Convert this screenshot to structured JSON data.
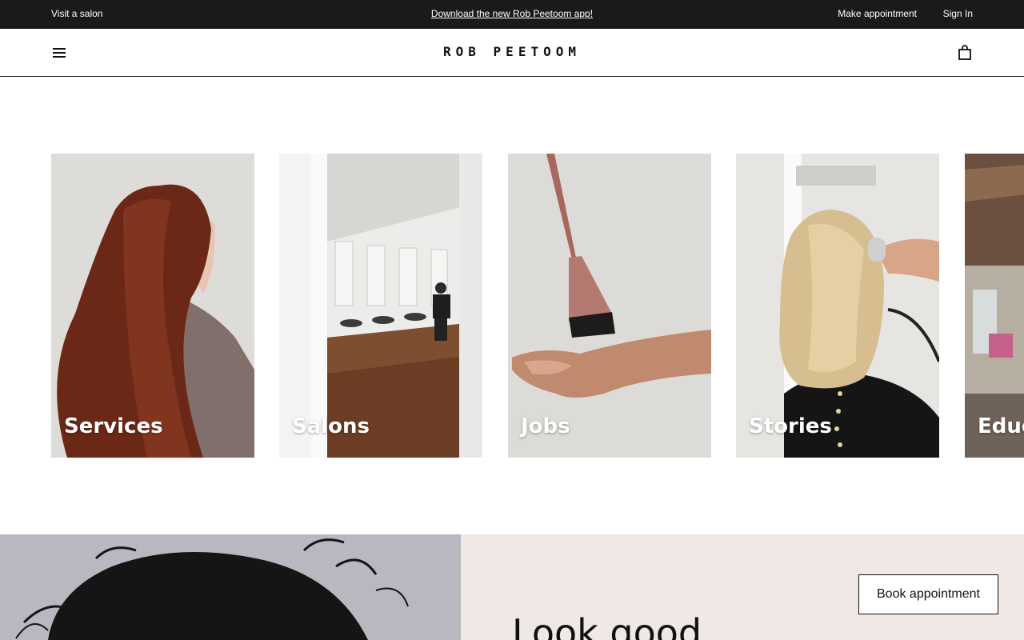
{
  "topbar": {
    "visit_salon": "Visit a salon",
    "download_app": "Download the new Rob Peetoom app!",
    "make_appointment": "Make appointment",
    "sign_in": "Sign In"
  },
  "header": {
    "logo": "ROB PEETOOM",
    "menu_icon": "hamburger-menu-icon",
    "cart_icon": "shopping-bag-icon"
  },
  "cards": [
    {
      "label": "Services"
    },
    {
      "label": "Salons"
    },
    {
      "label": "Jobs"
    },
    {
      "label": "Stories"
    },
    {
      "label": "Educ"
    }
  ],
  "promo": {
    "book_button": "Book appointment",
    "headline": "Look good"
  },
  "colors": {
    "topbar_bg": "#1a1a1a",
    "promo_bg": "#f0e8e4"
  }
}
